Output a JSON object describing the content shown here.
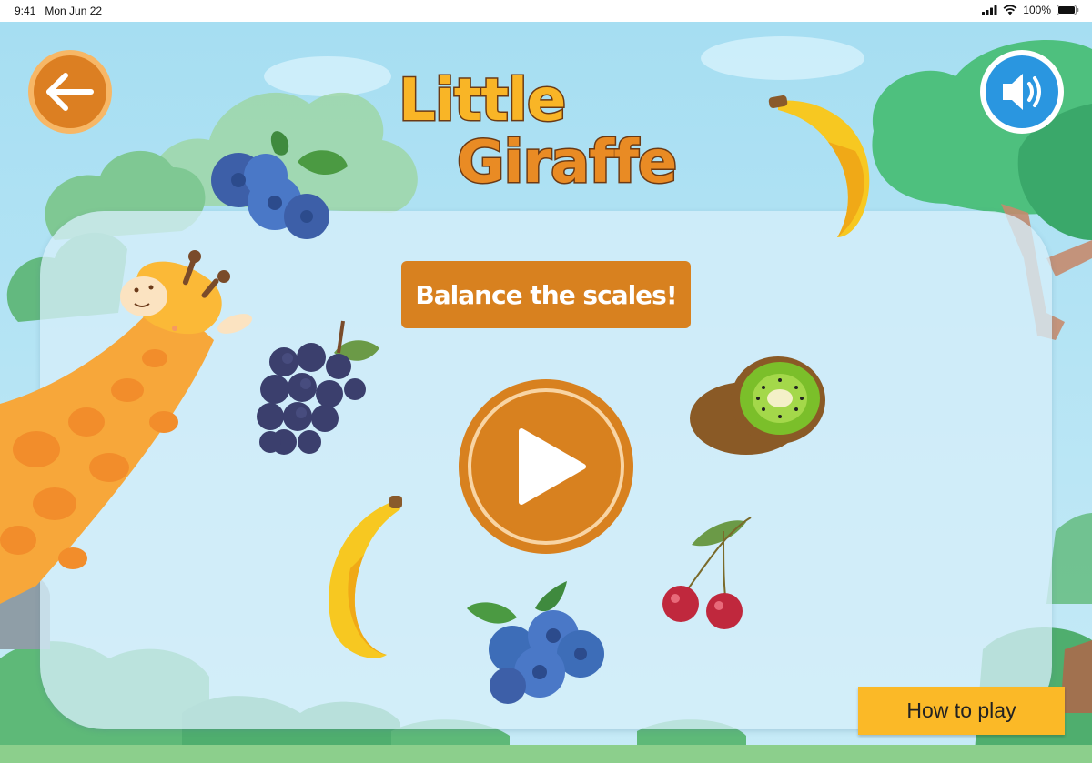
{
  "status_bar": {
    "time": "9:41",
    "date": "Mon Jun 22",
    "battery": "100%"
  },
  "title": {
    "line1": "Little",
    "line2": "Giraffe"
  },
  "banner": {
    "label": "Balance the scales!"
  },
  "how_to_play": {
    "label": "How to play"
  },
  "colors": {
    "accent_orange": "#d8811f",
    "sound_blue": "#2a96e0",
    "how_to_yellow": "#fbb927",
    "title_yellow": "#f9b526"
  },
  "icons": [
    "back-arrow-icon",
    "speaker-icon",
    "play-icon",
    "signal-icon",
    "wifi-icon",
    "battery-icon"
  ]
}
